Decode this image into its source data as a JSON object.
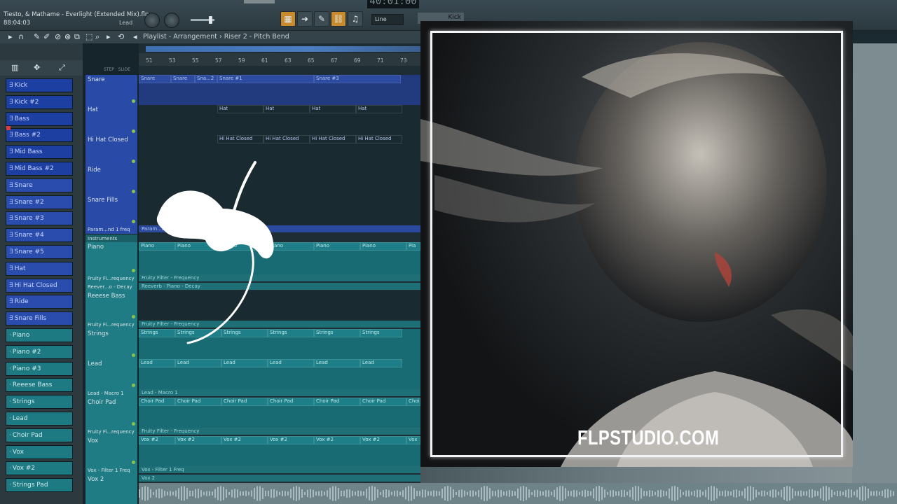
{
  "project": {
    "title": "Tiesto, & Mathame - Everlight (Extended Mix).flp",
    "time": "88:04:03",
    "section": "Lead"
  },
  "transport": {
    "tempo": "40:01:00",
    "mode": "Line",
    "channel": "Kick"
  },
  "toolbar": {
    "breadcrumb": "Playlist - Arrangement  ›  Riser 2 - Pitch Bend"
  },
  "ruler": [
    "51",
    "53",
    "55",
    "57",
    "59",
    "61",
    "63",
    "65",
    "67",
    "69",
    "71",
    "73"
  ],
  "channels": [
    {
      "label": "Kick",
      "color": "blue"
    },
    {
      "label": "Kick #2",
      "color": "blue"
    },
    {
      "label": "Bass",
      "color": "blue"
    },
    {
      "label": "Bass #2",
      "color": "blue"
    },
    {
      "label": "Mid Bass",
      "color": "blue"
    },
    {
      "label": "Mid Bass #2",
      "color": "blue"
    },
    {
      "label": "Snare",
      "color": "blue2"
    },
    {
      "label": "Snare #2",
      "color": "blue2"
    },
    {
      "label": "Snare #3",
      "color": "blue2"
    },
    {
      "label": "Snare #4",
      "color": "blue2"
    },
    {
      "label": "Snare #5",
      "color": "blue2"
    },
    {
      "label": "Hat",
      "color": "blue2"
    },
    {
      "label": "Hi Hat Closed",
      "color": "blue2"
    },
    {
      "label": "Ride",
      "color": "blue2"
    },
    {
      "label": "Snare Fills",
      "color": "blue2"
    },
    {
      "label": "Piano",
      "color": "teal"
    },
    {
      "label": "Piano #2",
      "color": "teal"
    },
    {
      "label": "Piano #3",
      "color": "teal"
    },
    {
      "label": "Reeese Bass",
      "color": "teal"
    },
    {
      "label": "Strings",
      "color": "teal"
    },
    {
      "label": "Lead",
      "color": "teal"
    },
    {
      "label": "Choir Pad",
      "color": "teal"
    },
    {
      "label": "Vox",
      "color": "teal"
    },
    {
      "label": "Vox #2",
      "color": "teal"
    },
    {
      "label": "Strings Pad",
      "color": "teal"
    }
  ],
  "tracks": {
    "snare": "Snare",
    "hat": "Hat",
    "hihat": "Hi Hat Closed",
    "ride": "Ride",
    "fills": "Snare Fills",
    "param": "Param...nd 1 freq",
    "instruments": "Instruments",
    "piano": "Piano",
    "fruity1": "Fruity Fi...requency",
    "reverb": "Reever...o - Decay",
    "reese": "Reeese Bass",
    "fruity2": "Fruity Fi...requency",
    "strings": "Strings",
    "lead": "Lead",
    "leadmacro": "Lead - Macro 1",
    "choir": "Choir Pad",
    "fruity3": "Fruity Fi...requency",
    "vox": "Vox",
    "voxfilter": "Vox - Filter 1 Freq",
    "vox2": "Vox 2"
  },
  "clips": {
    "snare": [
      "Snare",
      "Snare",
      "Sna...2",
      "Snare #1",
      "Snare #3"
    ],
    "hat": [
      "Hat",
      "Hat",
      "Hat",
      "Hat"
    ],
    "hihat": [
      "Hi Hat Closed",
      "Hi Hat Closed",
      "Hi Hat Closed",
      "Hi Hat Closed"
    ],
    "param": "Param...EQ 2 - Snare",
    "piano": [
      "Piano",
      "Piano",
      "Piano",
      "Piano",
      "Piano",
      "Piano",
      "Pia"
    ],
    "fruity1": "Fruity Filter - Frequency",
    "reverb": "Reeverb - Piano - Decay",
    "fruity2": "Fruity Filter - Frequency",
    "strings": [
      "Strings",
      "Strings",
      "Strings",
      "Strings",
      "Strings",
      "Strings"
    ],
    "lead": [
      "Lead",
      "Lead",
      "Lead",
      "Lead",
      "Lead",
      "Lead"
    ],
    "leadmacro": "Lead - Macro 1",
    "choir": [
      "Choir Pad",
      "Choir Pad",
      "Choir Pad",
      "Choir Pad",
      "Choir Pad",
      "Choir Pad",
      "Choi"
    ],
    "fruity3": "Fruity Filter - Frequency",
    "vox": [
      "Vox #2",
      "Vox #2",
      "Vox #2",
      "Vox #2",
      "Vox #2",
      "Vox #2",
      "Vox"
    ],
    "voxfilter": "Vox - Filter 1 Freq",
    "vox2": "Vox 2"
  },
  "art": {
    "watermark": "FLPSTUDIO.COM"
  }
}
